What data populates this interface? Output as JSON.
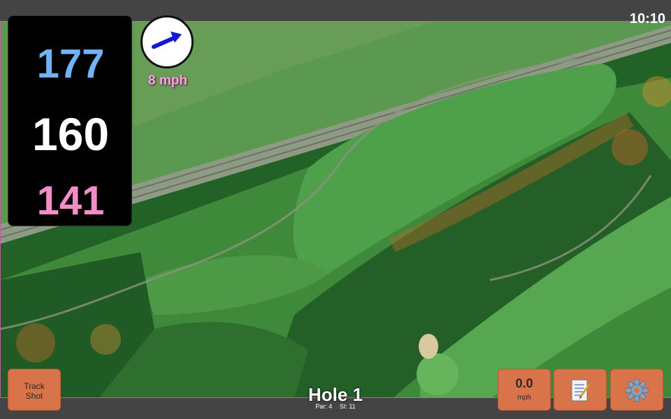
{
  "status_bar": {
    "time": "10:10"
  },
  "yardages": {
    "back": "177",
    "middle": "160",
    "front": "141"
  },
  "wind": {
    "speed_label": "8 mph",
    "icon": "wind-arrow-icon"
  },
  "hole": {
    "title": "Hole 1",
    "par": "Par: 4",
    "stroke_index": "SI: 11"
  },
  "buttons": {
    "track_shot": "Track\nShot",
    "speed_value": "0.0",
    "speed_unit": "mph",
    "notes_icon": "notepad-icon",
    "settings_icon": "gear-icon"
  },
  "colors": {
    "back_yardage": "#6fb3f5",
    "middle_yardage": "#ffffff",
    "front_yardage": "#f28dc8",
    "button": "#d9734a",
    "wind_label": "#f7a6df"
  }
}
